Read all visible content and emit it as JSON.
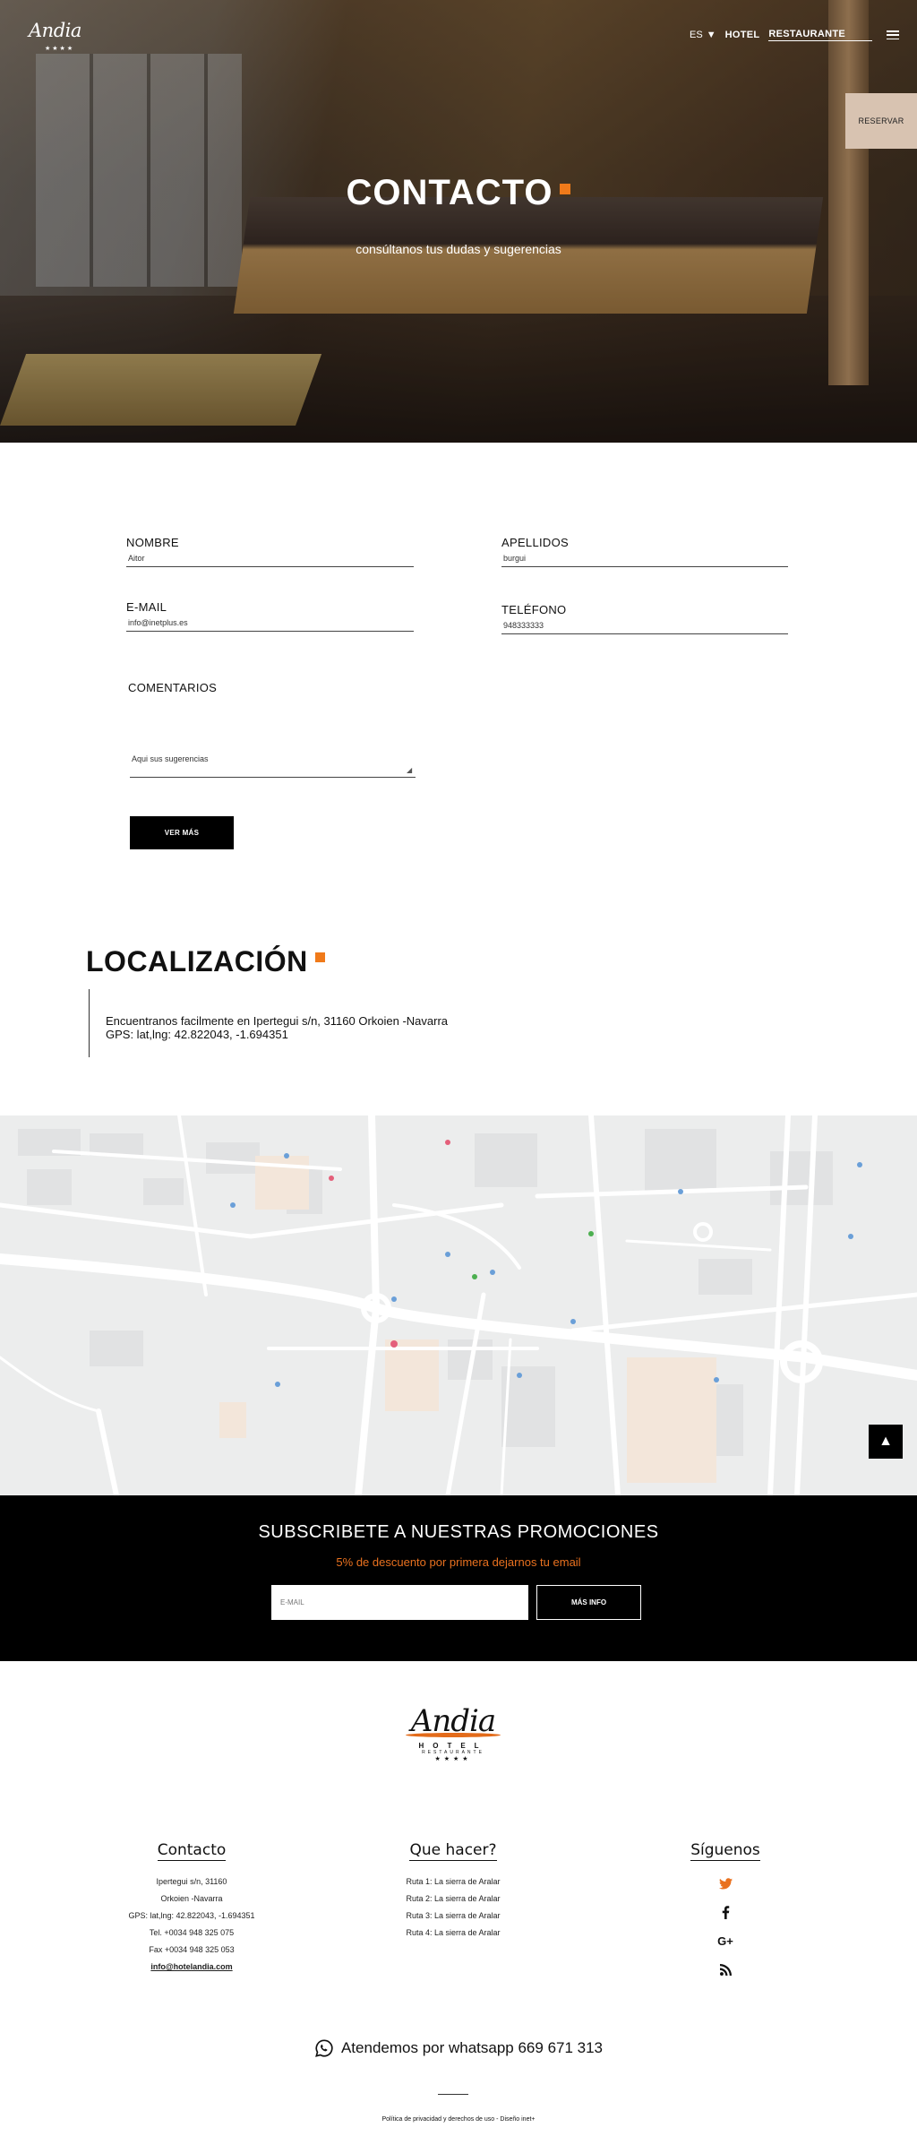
{
  "header": {
    "logo_text": "Andia",
    "logo_stars": "★★★★",
    "lang": "ES",
    "nav": [
      "HOTEL",
      "RESTAURANTE"
    ],
    "reserve_label": "RESERVAR"
  },
  "hero": {
    "title": "CONTACTO",
    "subtitle": "consúltanos tus dudas y sugerencias"
  },
  "form": {
    "nombre": {
      "label": "NOMBRE",
      "value": "Aitor"
    },
    "apellidos": {
      "label": "APELLIDOS",
      "value": "burgui"
    },
    "email": {
      "label": "E-MAIL",
      "value": "info@inetplus.es"
    },
    "telefono": {
      "label": "TELÉFONO",
      "value": "948333333"
    },
    "comentarios": {
      "label": "COMENTARIOS",
      "value": "Aqui sus sugerencias"
    },
    "submit_label": "VER MÁS"
  },
  "location": {
    "title": "LOCALIZACIÓN",
    "address": "Encuentranos facilmente en Ipertegui s/n, 31160 Orkoien -Navarra",
    "gps": "GPS: lat,lng: 42.822043, -1.694351"
  },
  "subscribe": {
    "title": "SUBSCRIBETE A NUESTRAS PROMOCIONES",
    "description": "5% de descuento por primera dejarnos tu email",
    "placeholder": "E-MAIL",
    "button_label": "MÁS INFO"
  },
  "footer": {
    "logo_name": "Andia",
    "logo_hotel": "HOTEL",
    "logo_rest": "RESTAURANTE",
    "logo_stars": "★★★★",
    "contacto": {
      "title": "Contacto",
      "lines": [
        "Ipertegui s/n, 31160",
        "Orkoien -Navarra",
        "GPS: lat,lng: 42.822043, -1.694351",
        "Tel. +0034 948 325 075",
        "Fax +0034 948 325 053"
      ],
      "email": "info@hotelandia.com"
    },
    "que_hacer": {
      "title": "Que hacer?",
      "routes": [
        "Ruta 1: La sierra de Aralar",
        "Ruta 2: La sierra de Aralar",
        "Ruta 3: La sierra de Aralar",
        "Ruta 4: La sierra de Aralar"
      ]
    },
    "siguenos": {
      "title": "Síguenos"
    },
    "whatsapp": "Atendemos por whatsapp 669 671 313",
    "legal": "Política de privacidad y derechos de uso - Diseño inet+"
  },
  "colors": {
    "accent": "#f07a1a",
    "dark": "#000000",
    "reserve_bg": "#d8c3b1",
    "twitter": "#e9711f"
  }
}
